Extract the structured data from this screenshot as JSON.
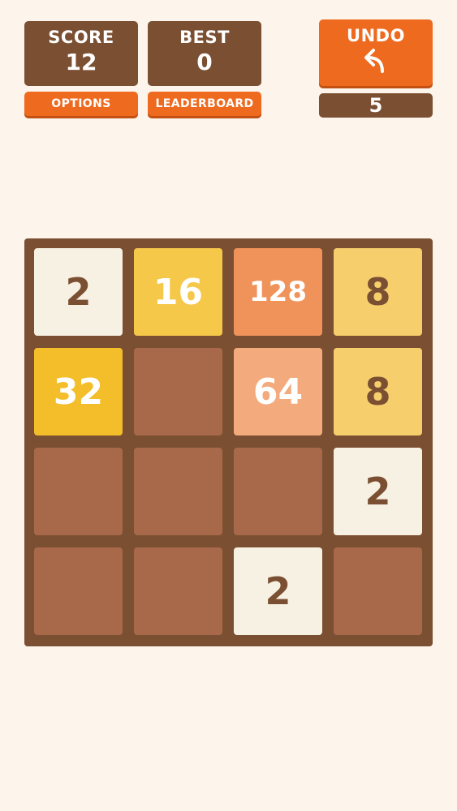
{
  "score": {
    "label": "SCORE",
    "value": "12"
  },
  "best": {
    "label": "BEST",
    "value": "0"
  },
  "undo": {
    "label": "UNDO",
    "count": "5"
  },
  "buttons": {
    "options": "OPTIONS",
    "leaderboard": "LEADERBOARD"
  },
  "board": {
    "rows": [
      [
        "2",
        "16",
        "128",
        "8"
      ],
      [
        "32",
        "",
        "64",
        "8"
      ],
      [
        "",
        "",
        "",
        "2"
      ],
      [
        "",
        "",
        "2",
        ""
      ]
    ]
  },
  "colors": {
    "background": "#fdf5eb",
    "panel": "#7b4f32",
    "accent": "#ee6a1f",
    "empty_cell": "#a8694a",
    "tile_2": "#f7f1e3",
    "tile_8": "#f6cf6c",
    "tile_16": "#f6c84a",
    "tile_32": "#f4be2a",
    "tile_64": "#f3aa7c",
    "tile_128": "#f0935a",
    "dark_text": "#7b4f32",
    "light_text": "#ffffff"
  }
}
